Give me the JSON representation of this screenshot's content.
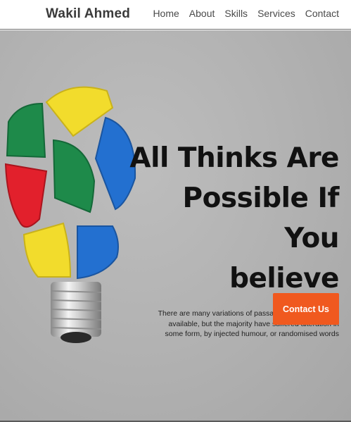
{
  "brand": {
    "name": "Wakil Ahmed"
  },
  "nav": {
    "items": [
      {
        "label": "Home"
      },
      {
        "label": "About"
      },
      {
        "label": "Skills"
      },
      {
        "label": "Services"
      },
      {
        "label": "Contact"
      }
    ]
  },
  "hero": {
    "headline_line1": "All Thinks Are",
    "headline_line2": "Possible If You",
    "headline_line3": "believe",
    "subtext": "There are many variations of passages of Lorem Ipsum available, but the majority have suffered alteration in some form, by injected humour, or randomised words",
    "cta_label": "Contact Us"
  },
  "colors": {
    "accent": "#f0591f",
    "hero_background": "#b4b4b4",
    "puzzle_yellow": "#f2dc2c",
    "puzzle_green": "#1e8a4a",
    "puzzle_red": "#e2202c",
    "puzzle_blue": "#2370d0"
  }
}
